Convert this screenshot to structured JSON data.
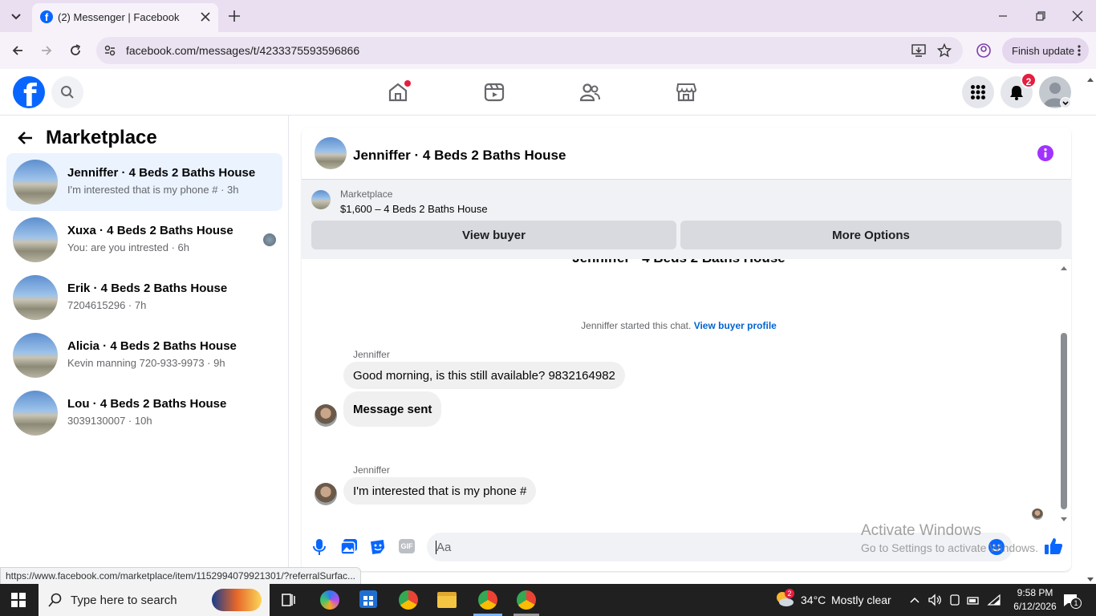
{
  "browser": {
    "tab_title": "(2) Messenger | Facebook",
    "url": "facebook.com/messages/t/4233375593596866",
    "finish_update_label": "Finish update",
    "status_url": "https://www.facebook.com/marketplace/item/1152994079921301/?referralSurfac..."
  },
  "header": {
    "notification_count": "2"
  },
  "sidebar": {
    "title": "Marketplace",
    "conversations": [
      {
        "name": "Jenniffer · 4 Beds 2 Baths House",
        "snippet": "I'm interested that is my phone # · 3h"
      },
      {
        "name": "Xuxa · 4 Beds 2 Baths House",
        "snippet": "You: are you intrested · 6h"
      },
      {
        "name": "Erik · 4 Beds 2 Baths House",
        "snippet": "7204615296 · 7h"
      },
      {
        "name": "Alicia · 4 Beds 2 Baths House",
        "snippet": "Kevin manning 720-933-9973 · 9h"
      },
      {
        "name": "Lou · 4 Beds 2 Baths House",
        "snippet": "3039130007 · 10h"
      }
    ]
  },
  "chat": {
    "title": "Jenniffer · 4 Beds 2 Baths House",
    "marketplace_label": "Marketplace",
    "listing": "$1,600 – 4 Beds 2 Baths House",
    "view_buyer_label": "View buyer",
    "more_options_label": "More Options",
    "scrolled_title": "Jenniffer · 4 Beds 2 Baths House",
    "started_text": "Jenniffer started this chat.",
    "view_profile_label": "View buyer profile",
    "sender_1": "Jenniffer",
    "msg_1": "Good morning, is this still available? 9832164982",
    "msg_2": "Message sent",
    "sender_2": "Jenniffer",
    "msg_3": "I'm interested that is my phone #",
    "input_placeholder": "Aa",
    "gif_label": "GIF"
  },
  "watermark": {
    "line1": "Activate Windows",
    "line2": "Go to Settings to activate Windows."
  },
  "taskbar": {
    "search_placeholder": "Type here to search",
    "weather_badge": "2",
    "temperature": "34°C",
    "weather": "Mostly clear",
    "time": "9:58 PM",
    "date": "6/12/2026",
    "notif_count": "1"
  },
  "colors": {
    "facebook_blue": "#0866ff",
    "badge_red": "#e41e3f",
    "info_purple": "#a033ff"
  }
}
